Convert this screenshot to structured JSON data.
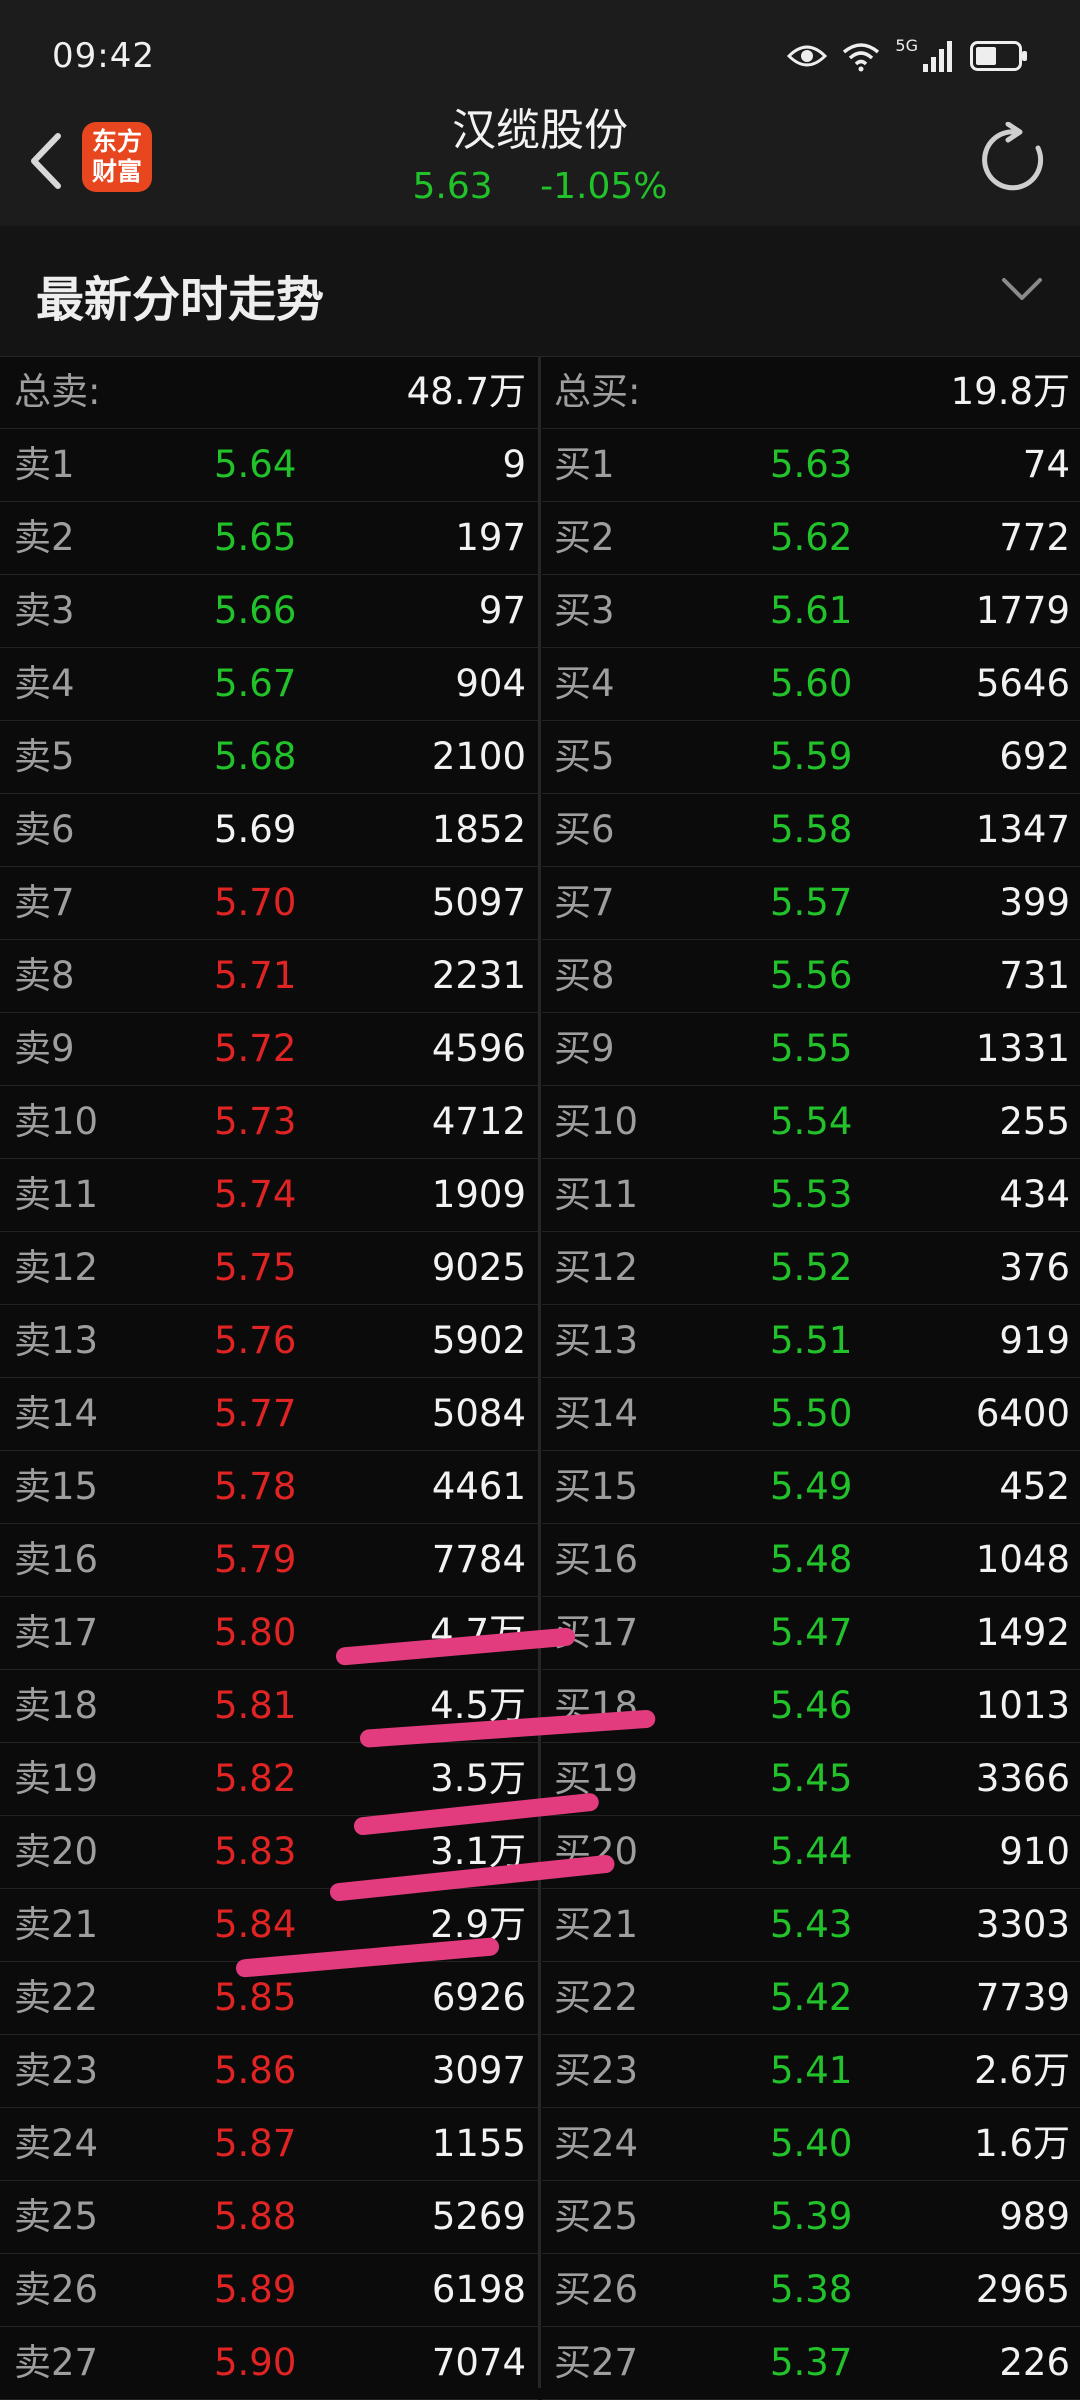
{
  "status": {
    "time": "09:42",
    "net": "5G"
  },
  "header": {
    "logo_line1": "东方",
    "logo_line2": "财富",
    "name": "汉缆股份",
    "price": "5.63",
    "change": "-1.05%"
  },
  "section": {
    "title": "最新分时走势"
  },
  "totals": {
    "sell_label": "总卖:",
    "sell_value": "48.7万",
    "buy_label": "总买:",
    "buy_value": "19.8万"
  },
  "colors": {
    "up": "#e02323",
    "down": "#22c22a",
    "flat": "#f2f2f2",
    "accent": "#e8461e",
    "highlight": "#e23b7e"
  },
  "sell": [
    {
      "label": "卖1",
      "price": "5.64",
      "qty": "9",
      "color": "green"
    },
    {
      "label": "卖2",
      "price": "5.65",
      "qty": "197",
      "color": "green"
    },
    {
      "label": "卖3",
      "price": "5.66",
      "qty": "97",
      "color": "green"
    },
    {
      "label": "卖4",
      "price": "5.67",
      "qty": "904",
      "color": "green"
    },
    {
      "label": "卖5",
      "price": "5.68",
      "qty": "2100",
      "color": "green"
    },
    {
      "label": "卖6",
      "price": "5.69",
      "qty": "1852",
      "color": "white"
    },
    {
      "label": "卖7",
      "price": "5.70",
      "qty": "5097",
      "color": "red"
    },
    {
      "label": "卖8",
      "price": "5.71",
      "qty": "2231",
      "color": "red"
    },
    {
      "label": "卖9",
      "price": "5.72",
      "qty": "4596",
      "color": "red"
    },
    {
      "label": "卖10",
      "price": "5.73",
      "qty": "4712",
      "color": "red"
    },
    {
      "label": "卖11",
      "price": "5.74",
      "qty": "1909",
      "color": "red"
    },
    {
      "label": "卖12",
      "price": "5.75",
      "qty": "9025",
      "color": "red"
    },
    {
      "label": "卖13",
      "price": "5.76",
      "qty": "5902",
      "color": "red"
    },
    {
      "label": "卖14",
      "price": "5.77",
      "qty": "5084",
      "color": "red"
    },
    {
      "label": "卖15",
      "price": "5.78",
      "qty": "4461",
      "color": "red"
    },
    {
      "label": "卖16",
      "price": "5.79",
      "qty": "7784",
      "color": "red"
    },
    {
      "label": "卖17",
      "price": "5.80",
      "qty": "4.7万",
      "color": "red"
    },
    {
      "label": "卖18",
      "price": "5.81",
      "qty": "4.5万",
      "color": "red"
    },
    {
      "label": "卖19",
      "price": "5.82",
      "qty": "3.5万",
      "color": "red"
    },
    {
      "label": "卖20",
      "price": "5.83",
      "qty": "3.1万",
      "color": "red"
    },
    {
      "label": "卖21",
      "price": "5.84",
      "qty": "2.9万",
      "color": "red"
    },
    {
      "label": "卖22",
      "price": "5.85",
      "qty": "6926",
      "color": "red"
    },
    {
      "label": "卖23",
      "price": "5.86",
      "qty": "3097",
      "color": "red"
    },
    {
      "label": "卖24",
      "price": "5.87",
      "qty": "1155",
      "color": "red"
    },
    {
      "label": "卖25",
      "price": "5.88",
      "qty": "5269",
      "color": "red"
    },
    {
      "label": "卖26",
      "price": "5.89",
      "qty": "6198",
      "color": "red"
    },
    {
      "label": "卖27",
      "price": "5.90",
      "qty": "7074",
      "color": "red"
    }
  ],
  "buy": [
    {
      "label": "买1",
      "price": "5.63",
      "qty": "74",
      "color": "green"
    },
    {
      "label": "买2",
      "price": "5.62",
      "qty": "772",
      "color": "green"
    },
    {
      "label": "买3",
      "price": "5.61",
      "qty": "1779",
      "color": "green"
    },
    {
      "label": "买4",
      "price": "5.60",
      "qty": "5646",
      "color": "green"
    },
    {
      "label": "买5",
      "price": "5.59",
      "qty": "692",
      "color": "green"
    },
    {
      "label": "买6",
      "price": "5.58",
      "qty": "1347",
      "color": "green"
    },
    {
      "label": "买7",
      "price": "5.57",
      "qty": "399",
      "color": "green"
    },
    {
      "label": "买8",
      "price": "5.56",
      "qty": "731",
      "color": "green"
    },
    {
      "label": "买9",
      "price": "5.55",
      "qty": "1331",
      "color": "green"
    },
    {
      "label": "买10",
      "price": "5.54",
      "qty": "255",
      "color": "green"
    },
    {
      "label": "买11",
      "price": "5.53",
      "qty": "434",
      "color": "green"
    },
    {
      "label": "买12",
      "price": "5.52",
      "qty": "376",
      "color": "green"
    },
    {
      "label": "买13",
      "price": "5.51",
      "qty": "919",
      "color": "green"
    },
    {
      "label": "买14",
      "price": "5.50",
      "qty": "6400",
      "color": "green"
    },
    {
      "label": "买15",
      "price": "5.49",
      "qty": "452",
      "color": "green"
    },
    {
      "label": "买16",
      "price": "5.48",
      "qty": "1048",
      "color": "green"
    },
    {
      "label": "买17",
      "price": "5.47",
      "qty": "1492",
      "color": "green"
    },
    {
      "label": "买18",
      "price": "5.46",
      "qty": "1013",
      "color": "green"
    },
    {
      "label": "买19",
      "price": "5.45",
      "qty": "3366",
      "color": "green"
    },
    {
      "label": "买20",
      "price": "5.44",
      "qty": "910",
      "color": "green"
    },
    {
      "label": "买21",
      "price": "5.43",
      "qty": "3303",
      "color": "green"
    },
    {
      "label": "买22",
      "price": "5.42",
      "qty": "7739",
      "color": "green"
    },
    {
      "label": "买23",
      "price": "5.41",
      "qty": "2.6万",
      "color": "green"
    },
    {
      "label": "买24",
      "price": "5.40",
      "qty": "1.6万",
      "color": "green"
    },
    {
      "label": "买25",
      "price": "5.39",
      "qty": "989",
      "color": "green"
    },
    {
      "label": "买26",
      "price": "5.38",
      "qty": "2965",
      "color": "green"
    },
    {
      "label": "买27",
      "price": "5.37",
      "qty": "226",
      "color": "green"
    }
  ]
}
